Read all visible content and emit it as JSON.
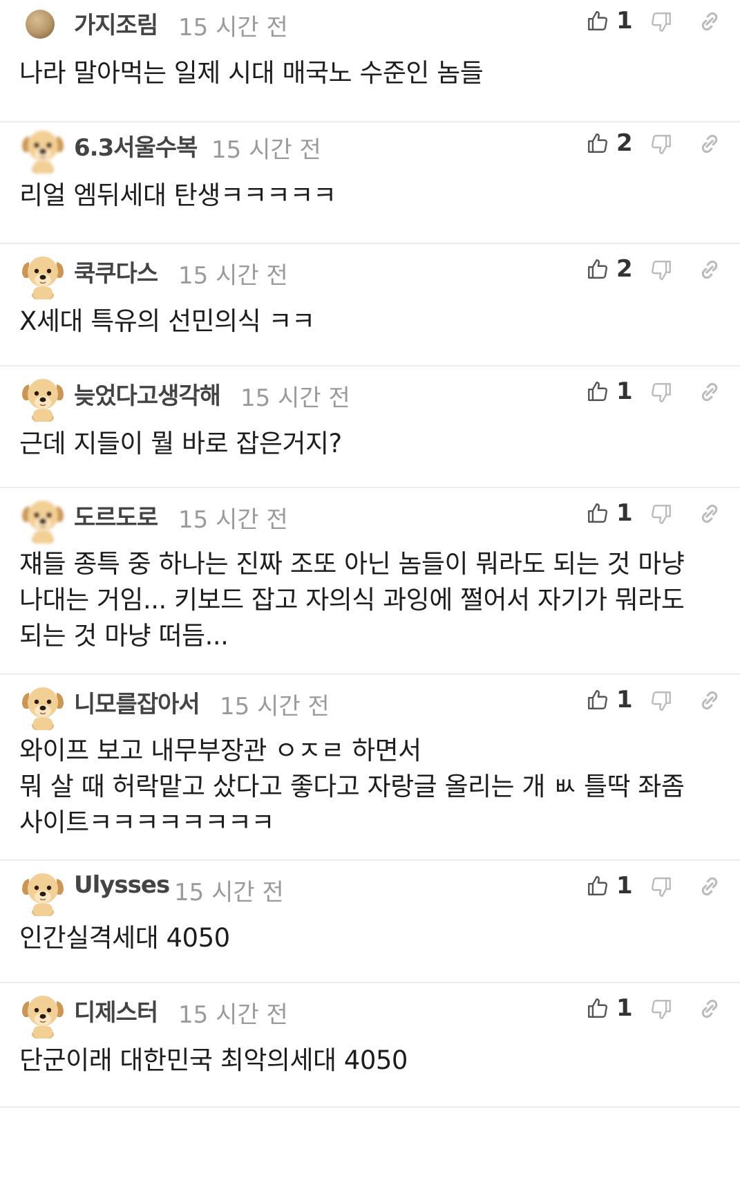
{
  "comments": [
    {
      "author": "가지조림",
      "time": "15 시간 전",
      "likes": "1",
      "avatar": "round-avatar",
      "lines": [
        "나라 말아먹는 일제 시대 매국노 수준인 놈들"
      ]
    },
    {
      "author": "6.3서울수복",
      "time": "15 시간 전",
      "likes": "2",
      "avatar": "puppy-avatar",
      "lines": [
        "리얼 엠뒤세대 탄생ㅋㅋㅋㅋㅋ"
      ]
    },
    {
      "author": "쿡쿠다스",
      "time": "15 시간 전",
      "likes": "2",
      "avatar": "puppy-avatar",
      "lines": [
        "X세대 특유의 선민의식 ㅋㅋ"
      ]
    },
    {
      "author": "늦었다고생각해",
      "time": "15 시간 전",
      "likes": "1",
      "avatar": "puppy-avatar",
      "lines": [
        "근데 지들이 뭘 바로 잡은거지?"
      ]
    },
    {
      "author": "도르도로",
      "time": "15 시간 전",
      "likes": "1",
      "avatar": "puppy-avatar",
      "lines": [
        "쟤들 종특 중 하나는 진짜 조또 아닌 놈들이 뭐라도 되는 것 마냥",
        "나대는 거임... 키보드 잡고 자의식 과잉에 쩔어서 자기가 뭐라도",
        "되는 것 마냥 떠듬..."
      ]
    },
    {
      "author": "니모를잡아서",
      "time": "15 시간 전",
      "likes": "1",
      "avatar": "puppy-avatar",
      "lines": [
        "와이프 보고 내무부장관 ㅇㅈㄹ 하면서",
        "뭐 살 때 허락맡고 샀다고 좋다고 자랑글 올리는 개 ㅄ 틀딱 좌좀",
        "사이트ㅋㅋㅋㅋㅋㅋㅋㅋ"
      ]
    },
    {
      "author": "Ulysses",
      "time": "15 시간 전",
      "likes": "1",
      "avatar": "puppy-avatar",
      "lines": [
        "인간실격세대 4050"
      ]
    },
    {
      "author": "디제스터",
      "time": "15 시간 전",
      "likes": "1",
      "avatar": "puppy-avatar",
      "lines": [
        "단군이래 대한민국 최악의세대 4050"
      ]
    }
  ],
  "icons": {
    "like": "thumbs-up-icon",
    "dislike": "thumbs-down-icon",
    "link": "link-icon"
  },
  "colors": {
    "author": "#444444",
    "time": "#9a9a9a",
    "divider": "#ececec",
    "icon": "#555555",
    "icon_faded": "#bbbbbb"
  }
}
